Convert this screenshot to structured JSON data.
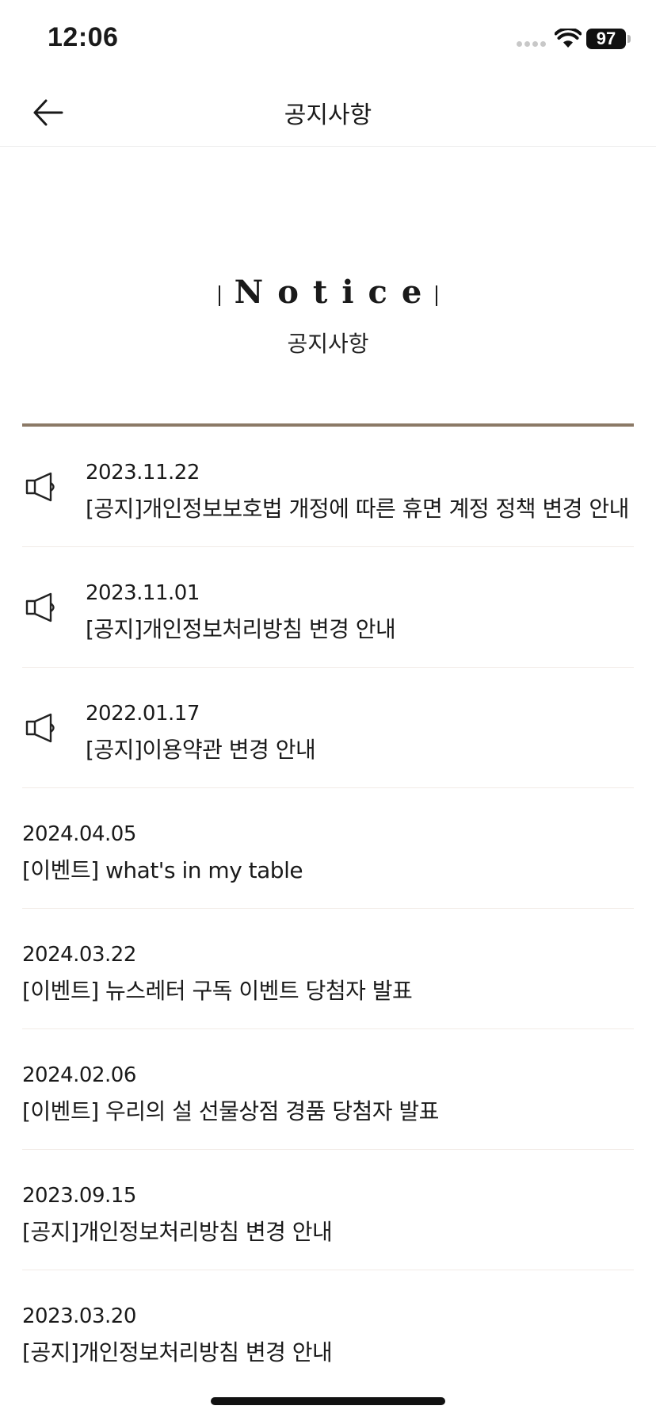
{
  "status_bar": {
    "time": "12:06",
    "battery": "97"
  },
  "nav": {
    "title": "공지사항",
    "back_icon": "arrow-left-icon"
  },
  "hero": {
    "title_en": "Notice",
    "title_ko": "공지사항"
  },
  "notices": [
    {
      "date": "2023.11.22",
      "title": "[공지]개인정보보호법 개정에 따른 휴면 계정 정책 변경 안내",
      "pinned": true,
      "icon": "megaphone-icon"
    },
    {
      "date": "2023.11.01",
      "title": "[공지]개인정보처리방침 변경 안내",
      "pinned": true,
      "icon": "megaphone-icon"
    },
    {
      "date": "2022.01.17",
      "title": "[공지]이용약관 변경 안내",
      "pinned": true,
      "icon": "megaphone-icon"
    },
    {
      "date": "2024.04.05",
      "title": "[이벤트] what's in my table",
      "pinned": false
    },
    {
      "date": "2024.03.22",
      "title": "[이벤트] 뉴스레터 구독 이벤트 당첨자 발표",
      "pinned": false
    },
    {
      "date": "2024.02.06",
      "title": "[이벤트] 우리의 설 선물상점 경품 당첨자 발표",
      "pinned": false
    },
    {
      "date": "2023.09.15",
      "title": "[공지]개인정보처리방침 변경 안내",
      "pinned": false
    },
    {
      "date": "2023.03.20",
      "title": "[공지]개인정보처리방침 변경 안내",
      "pinned": false
    }
  ],
  "colors": {
    "accent_divider": "#8b7966",
    "row_divider": "#f1ebe6"
  }
}
